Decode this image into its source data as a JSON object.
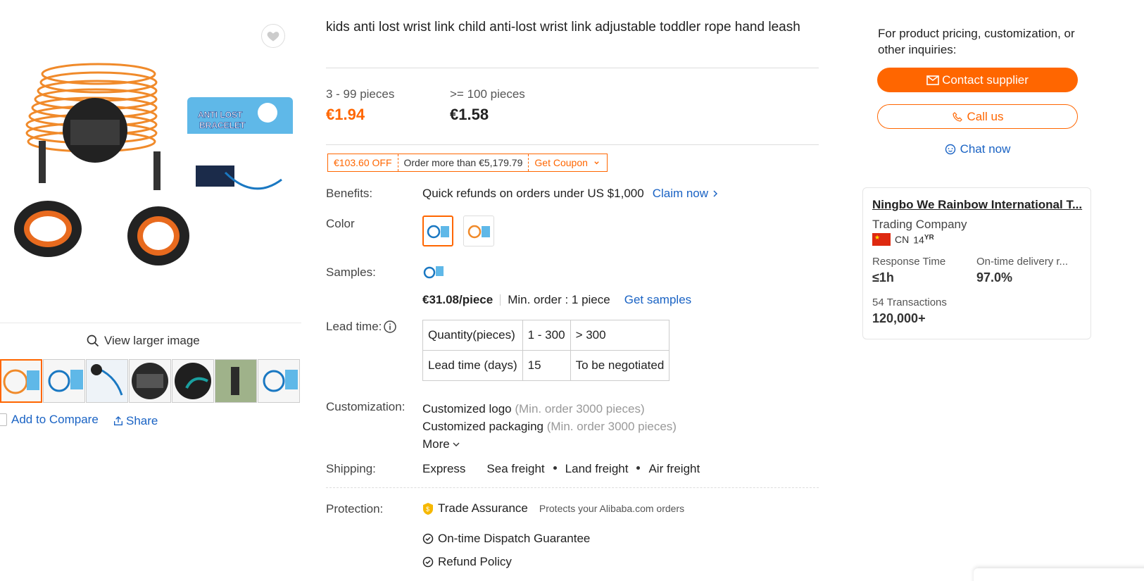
{
  "gallery": {
    "view_larger_label": "View larger image",
    "add_to_compare_label": "Add to Compare",
    "share_label": "Share",
    "product_box_text_1": "ANTI LOST",
    "product_box_text_2": "BRACELET",
    "thumbnail_count": 7
  },
  "product": {
    "title": "kids anti lost wrist link child anti-lost wrist link adjustable toddler rope hand leash",
    "tiers": [
      {
        "range": "3 - 99 pieces",
        "price": "€1.94"
      },
      {
        "range": ">= 100 pieces",
        "price": "€1.58"
      }
    ],
    "coupon": {
      "discount": "€103.60 OFF",
      "condition": "Order more than €5,179.79",
      "action": "Get Coupon"
    },
    "benefits": {
      "label": "Benefits:",
      "text": "Quick refunds on orders under US $1,000",
      "link": "Claim now"
    },
    "color": {
      "label": "Color"
    },
    "samples": {
      "label": "Samples:",
      "price": "€31.08/piece",
      "min_order": "Min. order : 1 piece",
      "link": "Get samples"
    },
    "lead_time": {
      "label": "Lead time:",
      "rows": [
        [
          "Quantity(pieces)",
          "1 - 300",
          "> 300"
        ],
        [
          "Lead time (days)",
          "15",
          "To be negotiated"
        ]
      ]
    },
    "customization": {
      "label": "Customization:",
      "items": [
        {
          "name": "Customized logo",
          "note": "(Min. order 3000 pieces)"
        },
        {
          "name": "Customized packaging",
          "note": "(Min. order 3000 pieces)"
        }
      ],
      "more": "More"
    },
    "shipping": {
      "label": "Shipping:",
      "options": [
        "Express",
        "Sea freight",
        "Land freight",
        "Air freight"
      ]
    },
    "protection": {
      "label": "Protection:",
      "trade_assurance": "Trade Assurance",
      "trade_assurance_note": "Protects your Alibaba.com orders",
      "guarantees": [
        "On-time Dispatch Guarantee",
        "Refund Policy"
      ]
    }
  },
  "supplier_panel": {
    "inquiry_text": "For product pricing, customization, or other inquiries:",
    "contact_button": "Contact supplier",
    "call_button": "Call us",
    "chat_link": "Chat now",
    "card": {
      "name": "Ningbo We Rainbow International T...",
      "type": "Trading Company",
      "country": "CN",
      "years": "14",
      "years_unit": "YR",
      "response_time_label": "Response Time",
      "response_time_value": "≤1h",
      "ontime_label": "On-time delivery r...",
      "ontime_value": "97.0%",
      "transactions_label": "54 Transactions",
      "transactions_value": "120,000+"
    }
  },
  "colors": {
    "accent": "#ff6600",
    "link": "#1a63c4"
  }
}
